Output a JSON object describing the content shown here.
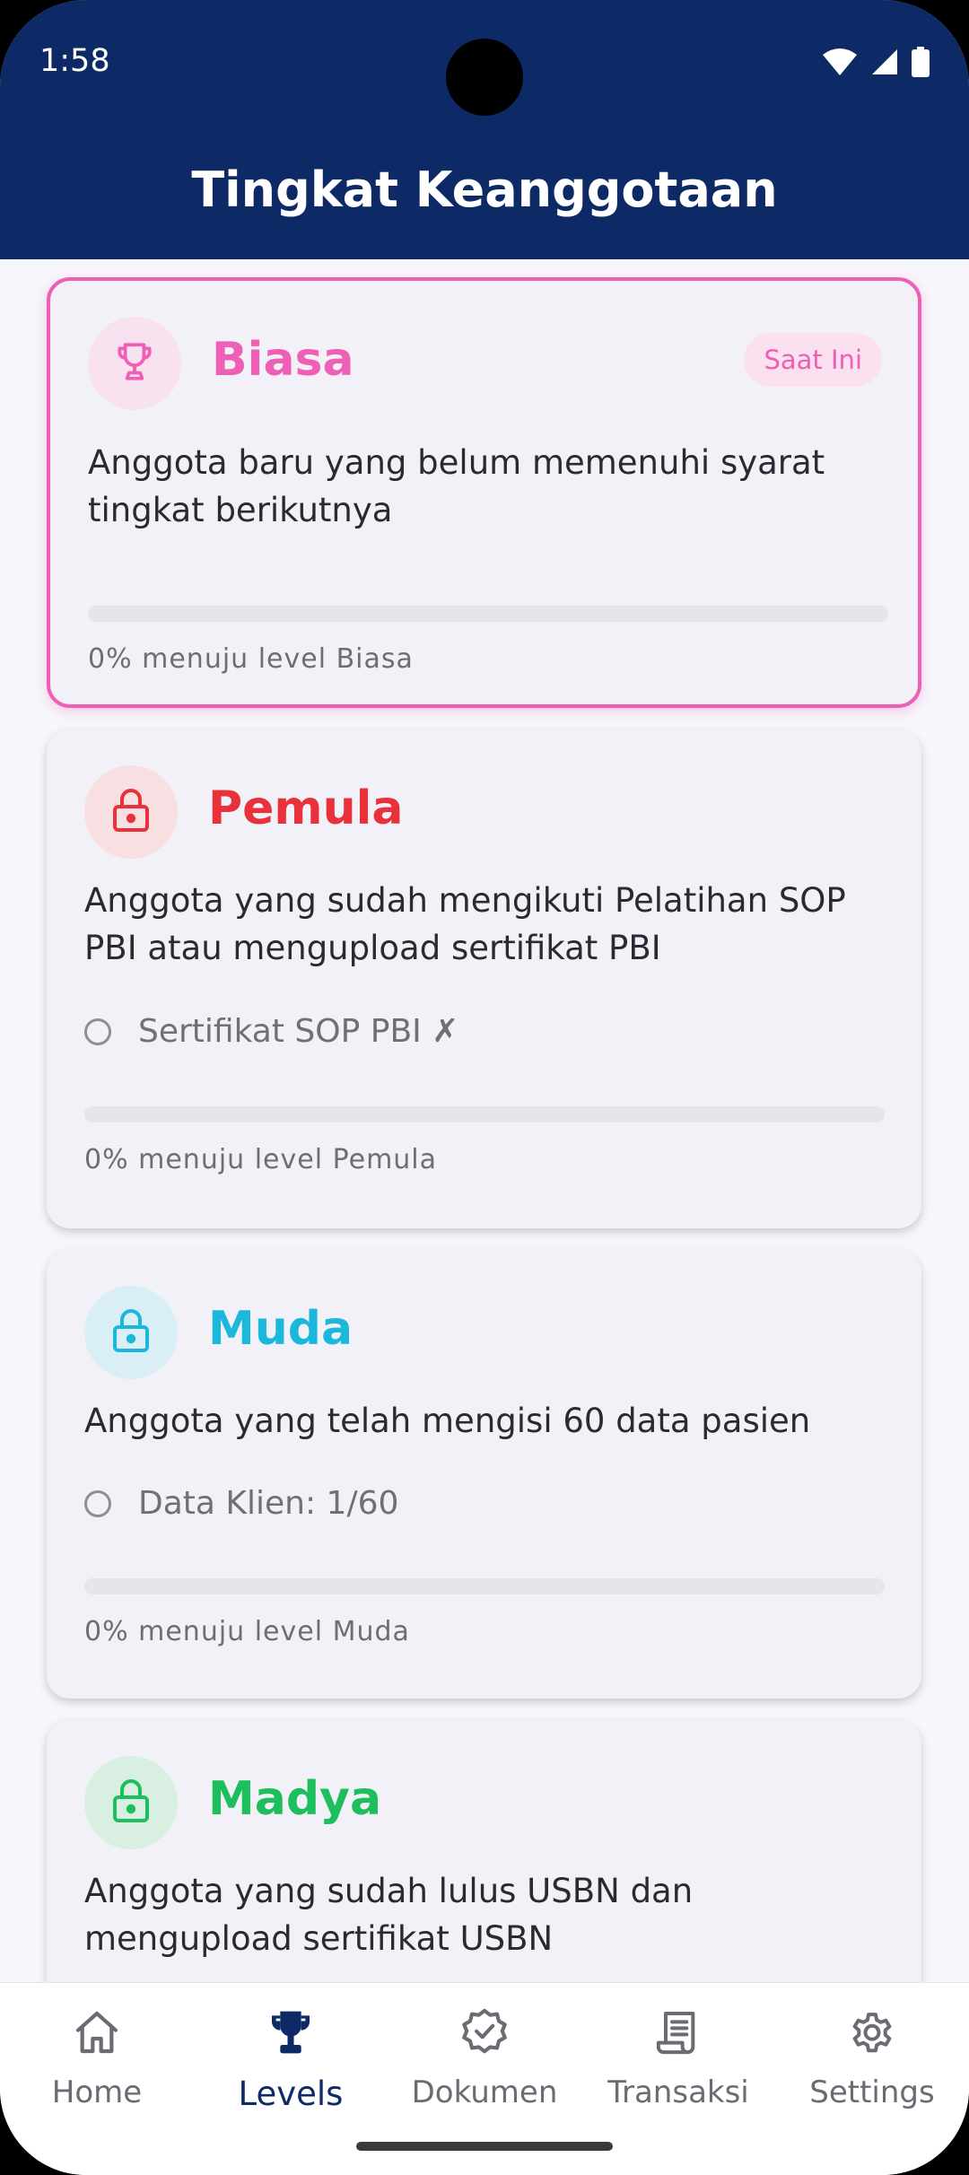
{
  "status_bar": {
    "time": "1:58",
    "icons": [
      "wifi-icon",
      "signal-icon",
      "battery-icon"
    ]
  },
  "header": {
    "title": "Tingkat Keanggotaan"
  },
  "levels": [
    {
      "name": "Biasa",
      "icon": "trophy-icon",
      "color": "#ee5fb5",
      "badge": "Saat Ini",
      "description": "Anggota baru yang belum memenuhi syarat tingkat berikutnya",
      "requirement": "",
      "progress_percent": 0,
      "progress_label": "0% menuju level Biasa"
    },
    {
      "name": "Pemula",
      "icon": "lock-icon",
      "color": "#e8313a",
      "badge": "",
      "description": "Anggota yang sudah mengikuti Pelatihan SOP PBI atau mengupload sertifikat PBI",
      "requirement": "Sertifikat SOP PBI ✗",
      "progress_percent": 0,
      "progress_label": "0% menuju level Pemula"
    },
    {
      "name": "Muda",
      "icon": "lock-icon",
      "color": "#1cb8dc",
      "badge": "",
      "description": "Anggota yang telah mengisi 60 data pasien",
      "requirement": "Data Klien: 1/60",
      "progress_percent": 0,
      "progress_label": "0% menuju level Muda"
    },
    {
      "name": "Madya",
      "icon": "lock-icon",
      "color": "#1dbe5c",
      "badge": "",
      "description": "Anggota yang sudah lulus USBN dan mengupload sertifikat USBN",
      "requirement": "",
      "progress_percent": 0,
      "progress_label": ""
    }
  ],
  "bottom_nav": {
    "items": [
      {
        "label": "Home",
        "icon": "home-icon"
      },
      {
        "label": "Levels",
        "icon": "trophy-icon"
      },
      {
        "label": "Dokumen",
        "icon": "verified-badge-icon"
      },
      {
        "label": "Transaksi",
        "icon": "receipt-icon"
      },
      {
        "label": "Settings",
        "icon": "gear-icon"
      }
    ],
    "active": "Levels"
  },
  "colors": {
    "header_bg": "#0e2a66",
    "current_accent": "#ee5fb5"
  }
}
